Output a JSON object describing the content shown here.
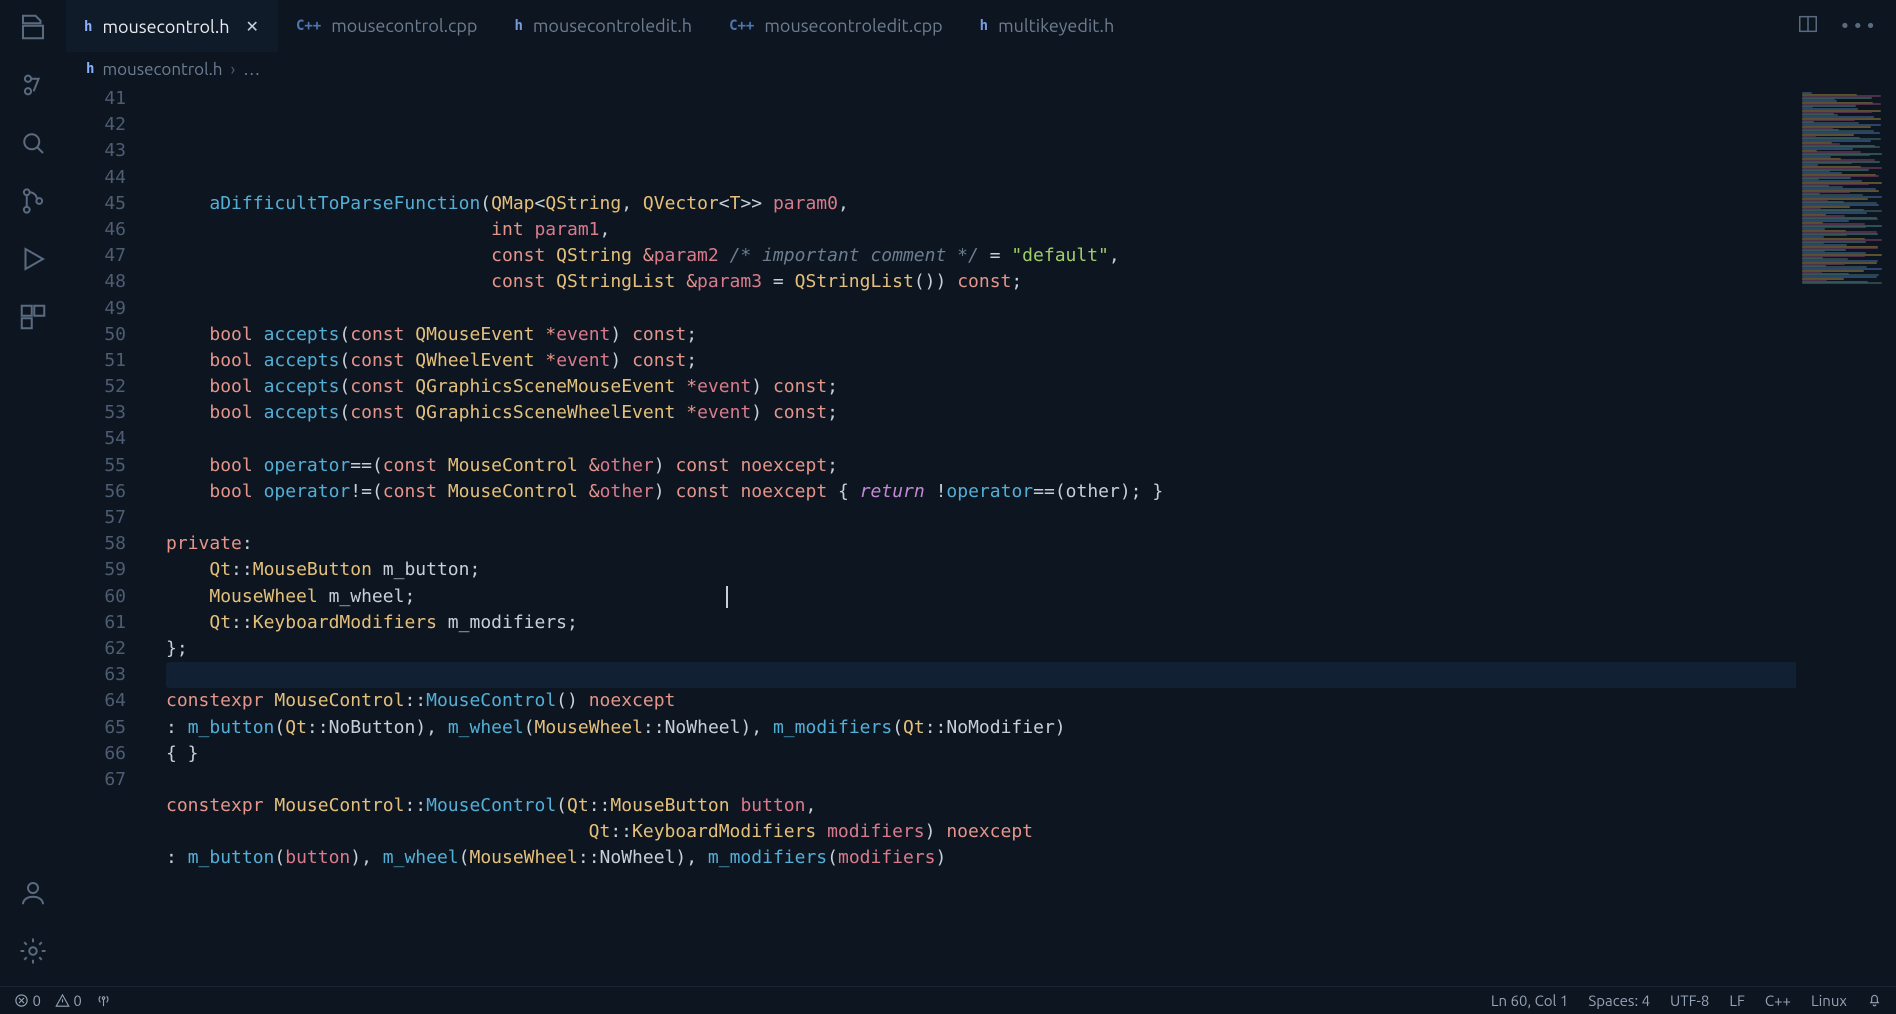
{
  "tabs": [
    {
      "icon": "h",
      "label": "mousecontrol.h",
      "active": true,
      "dirty": false
    },
    {
      "icon": "C++",
      "label": "mousecontrol.cpp",
      "active": false
    },
    {
      "icon": "h",
      "label": "mousecontroledit.h",
      "active": false
    },
    {
      "icon": "C++",
      "label": "mousecontroledit.cpp",
      "active": false
    },
    {
      "icon": "h",
      "label": "multikeyedit.h",
      "active": false
    }
  ],
  "breadcrumb": {
    "icon": "h",
    "file": "mousecontrol.h",
    "trail": "…"
  },
  "editor": {
    "first_line_number": 41,
    "active_line_number": 60,
    "lines": [
      {
        "n": 41,
        "tokens": []
      },
      {
        "n": 42,
        "tokens": [
          [
            "def",
            "    "
          ],
          [
            "func",
            "aDifficultToParseFunction"
          ],
          [
            "pun",
            "("
          ],
          [
            "type",
            "QMap"
          ],
          [
            "pun",
            "<"
          ],
          [
            "type",
            "QString"
          ],
          [
            "pun",
            ", "
          ],
          [
            "type",
            "QVector"
          ],
          [
            "pun",
            "<"
          ],
          [
            "type",
            "T"
          ],
          [
            "pun",
            ">> "
          ],
          [
            "par",
            "param0"
          ],
          [
            "pun",
            ","
          ]
        ]
      },
      {
        "n": 43,
        "tokens": [
          [
            "def",
            "                              "
          ],
          [
            "kw",
            "int"
          ],
          [
            "def",
            " "
          ],
          [
            "par",
            "param1"
          ],
          [
            "pun",
            ","
          ]
        ]
      },
      {
        "n": 44,
        "tokens": [
          [
            "def",
            "                              "
          ],
          [
            "kw",
            "const"
          ],
          [
            "def",
            " "
          ],
          [
            "type",
            "QString"
          ],
          [
            "def",
            " "
          ],
          [
            "kw",
            "&"
          ],
          [
            "par",
            "param2"
          ],
          [
            "def",
            " "
          ],
          [
            "com",
            "/* important comment */"
          ],
          [
            "def",
            " "
          ],
          [
            "pun",
            "="
          ],
          [
            "def",
            " "
          ],
          [
            "str",
            "\"default\""
          ],
          [
            "pun",
            ","
          ]
        ]
      },
      {
        "n": 45,
        "tokens": [
          [
            "def",
            "                              "
          ],
          [
            "kw",
            "const"
          ],
          [
            "def",
            " "
          ],
          [
            "type",
            "QStringList"
          ],
          [
            "def",
            " "
          ],
          [
            "kw",
            "&"
          ],
          [
            "par",
            "param3"
          ],
          [
            "def",
            " "
          ],
          [
            "pun",
            "="
          ],
          [
            "def",
            " "
          ],
          [
            "type",
            "QStringList"
          ],
          [
            "pun",
            "())"
          ],
          [
            "def",
            " "
          ],
          [
            "kw",
            "const"
          ],
          [
            "pun",
            ";"
          ]
        ]
      },
      {
        "n": 46,
        "tokens": []
      },
      {
        "n": 47,
        "tokens": [
          [
            "def",
            "    "
          ],
          [
            "kw",
            "bool"
          ],
          [
            "def",
            " "
          ],
          [
            "func",
            "accepts"
          ],
          [
            "pun",
            "("
          ],
          [
            "kw",
            "const"
          ],
          [
            "def",
            " "
          ],
          [
            "type",
            "QMouseEvent"
          ],
          [
            "def",
            " "
          ],
          [
            "kw",
            "*"
          ],
          [
            "par",
            "event"
          ],
          [
            "pun",
            ")"
          ],
          [
            "def",
            " "
          ],
          [
            "kw",
            "const"
          ],
          [
            "pun",
            ";"
          ]
        ]
      },
      {
        "n": 48,
        "tokens": [
          [
            "def",
            "    "
          ],
          [
            "kw",
            "bool"
          ],
          [
            "def",
            " "
          ],
          [
            "func",
            "accepts"
          ],
          [
            "pun",
            "("
          ],
          [
            "kw",
            "const"
          ],
          [
            "def",
            " "
          ],
          [
            "type",
            "QWheelEvent"
          ],
          [
            "def",
            " "
          ],
          [
            "kw",
            "*"
          ],
          [
            "par",
            "event"
          ],
          [
            "pun",
            ")"
          ],
          [
            "def",
            " "
          ],
          [
            "kw",
            "const"
          ],
          [
            "pun",
            ";"
          ]
        ]
      },
      {
        "n": 49,
        "tokens": [
          [
            "def",
            "    "
          ],
          [
            "kw",
            "bool"
          ],
          [
            "def",
            " "
          ],
          [
            "func",
            "accepts"
          ],
          [
            "pun",
            "("
          ],
          [
            "kw",
            "const"
          ],
          [
            "def",
            " "
          ],
          [
            "type",
            "QGraphicsSceneMouseEvent"
          ],
          [
            "def",
            " "
          ],
          [
            "kw",
            "*"
          ],
          [
            "par",
            "event"
          ],
          [
            "pun",
            ")"
          ],
          [
            "def",
            " "
          ],
          [
            "kw",
            "const"
          ],
          [
            "pun",
            ";"
          ]
        ]
      },
      {
        "n": 50,
        "tokens": [
          [
            "def",
            "    "
          ],
          [
            "kw",
            "bool"
          ],
          [
            "def",
            " "
          ],
          [
            "func",
            "accepts"
          ],
          [
            "pun",
            "("
          ],
          [
            "kw",
            "const"
          ],
          [
            "def",
            " "
          ],
          [
            "type",
            "QGraphicsSceneWheelEvent"
          ],
          [
            "def",
            " "
          ],
          [
            "kw",
            "*"
          ],
          [
            "par",
            "event"
          ],
          [
            "pun",
            ")"
          ],
          [
            "def",
            " "
          ],
          [
            "kw",
            "const"
          ],
          [
            "pun",
            ";"
          ]
        ]
      },
      {
        "n": 51,
        "tokens": []
      },
      {
        "n": 52,
        "tokens": [
          [
            "def",
            "    "
          ],
          [
            "kw",
            "bool"
          ],
          [
            "def",
            " "
          ],
          [
            "func",
            "operator"
          ],
          [
            "pun",
            "=="
          ],
          [
            "pun",
            "("
          ],
          [
            "kw",
            "const"
          ],
          [
            "def",
            " "
          ],
          [
            "type",
            "MouseControl"
          ],
          [
            "def",
            " "
          ],
          [
            "kw",
            "&"
          ],
          [
            "par",
            "other"
          ],
          [
            "pun",
            ")"
          ],
          [
            "def",
            " "
          ],
          [
            "kw",
            "const"
          ],
          [
            "def",
            " "
          ],
          [
            "kw",
            "noexcept"
          ],
          [
            "pun",
            ";"
          ]
        ]
      },
      {
        "n": 53,
        "tokens": [
          [
            "def",
            "    "
          ],
          [
            "kw",
            "bool"
          ],
          [
            "def",
            " "
          ],
          [
            "func",
            "operator"
          ],
          [
            "pun",
            "!="
          ],
          [
            "pun",
            "("
          ],
          [
            "kw",
            "const"
          ],
          [
            "def",
            " "
          ],
          [
            "type",
            "MouseControl"
          ],
          [
            "def",
            " "
          ],
          [
            "kw",
            "&"
          ],
          [
            "par",
            "other"
          ],
          [
            "pun",
            ")"
          ],
          [
            "def",
            " "
          ],
          [
            "kw",
            "const"
          ],
          [
            "def",
            " "
          ],
          [
            "kw",
            "noexcept"
          ],
          [
            "def",
            " "
          ],
          [
            "pun",
            "{"
          ],
          [
            "def",
            " "
          ],
          [
            "kw2",
            "return"
          ],
          [
            "def",
            " "
          ],
          [
            "pun",
            "!"
          ],
          [
            "func",
            "operator"
          ],
          [
            "pun",
            "=="
          ],
          [
            "pun",
            "("
          ],
          [
            "def",
            "other"
          ],
          [
            "pun",
            "); }"
          ]
        ]
      },
      {
        "n": 54,
        "tokens": []
      },
      {
        "n": 55,
        "tokens": [
          [
            "lbl",
            "private"
          ],
          [
            "pun",
            ":"
          ]
        ]
      },
      {
        "n": 56,
        "tokens": [
          [
            "def",
            "    "
          ],
          [
            "type",
            "Qt"
          ],
          [
            "pun",
            "::"
          ],
          [
            "type",
            "MouseButton"
          ],
          [
            "def",
            " m_button"
          ],
          [
            "pun",
            ";"
          ]
        ]
      },
      {
        "n": 57,
        "tokens": [
          [
            "def",
            "    "
          ],
          [
            "type",
            "MouseWheel"
          ],
          [
            "def",
            " m_wheel"
          ],
          [
            "pun",
            ";"
          ]
        ]
      },
      {
        "n": 58,
        "tokens": [
          [
            "def",
            "    "
          ],
          [
            "type",
            "Qt"
          ],
          [
            "pun",
            "::"
          ],
          [
            "type",
            "KeyboardModifiers"
          ],
          [
            "def",
            " m_modifiers"
          ],
          [
            "pun",
            ";"
          ]
        ]
      },
      {
        "n": 59,
        "tokens": [
          [
            "pun",
            "};"
          ]
        ]
      },
      {
        "n": 60,
        "tokens": []
      },
      {
        "n": 61,
        "tokens": [
          [
            "kw",
            "constexpr"
          ],
          [
            "def",
            " "
          ],
          [
            "type",
            "MouseControl"
          ],
          [
            "pun",
            "::"
          ],
          [
            "func",
            "MouseControl"
          ],
          [
            "pun",
            "()"
          ],
          [
            "def",
            " "
          ],
          [
            "kw",
            "noexcept"
          ]
        ]
      },
      {
        "n": 62,
        "tokens": [
          [
            "pun",
            ": "
          ],
          [
            "func",
            "m_button"
          ],
          [
            "pun",
            "("
          ],
          [
            "type",
            "Qt"
          ],
          [
            "pun",
            "::"
          ],
          [
            "def",
            "NoButton"
          ],
          [
            "pun",
            "), "
          ],
          [
            "func",
            "m_wheel"
          ],
          [
            "pun",
            "("
          ],
          [
            "type",
            "MouseWheel"
          ],
          [
            "pun",
            "::"
          ],
          [
            "def",
            "NoWheel"
          ],
          [
            "pun",
            "), "
          ],
          [
            "func",
            "m_modifiers"
          ],
          [
            "pun",
            "("
          ],
          [
            "type",
            "Qt"
          ],
          [
            "pun",
            "::"
          ],
          [
            "def",
            "NoModifier"
          ],
          [
            "pun",
            ")"
          ]
        ]
      },
      {
        "n": 63,
        "tokens": [
          [
            "pun",
            "{ }"
          ]
        ]
      },
      {
        "n": 64,
        "tokens": []
      },
      {
        "n": 65,
        "tokens": [
          [
            "kw",
            "constexpr"
          ],
          [
            "def",
            " "
          ],
          [
            "type",
            "MouseControl"
          ],
          [
            "pun",
            "::"
          ],
          [
            "func",
            "MouseControl"
          ],
          [
            "pun",
            "("
          ],
          [
            "type",
            "Qt"
          ],
          [
            "pun",
            "::"
          ],
          [
            "type",
            "MouseButton"
          ],
          [
            "def",
            " "
          ],
          [
            "par",
            "button"
          ],
          [
            "pun",
            ","
          ]
        ]
      },
      {
        "n": 66,
        "tokens": [
          [
            "def",
            "                                       "
          ],
          [
            "type",
            "Qt"
          ],
          [
            "pun",
            "::"
          ],
          [
            "type",
            "KeyboardModifiers"
          ],
          [
            "def",
            " "
          ],
          [
            "par",
            "modifiers"
          ],
          [
            "pun",
            ")"
          ],
          [
            "def",
            " "
          ],
          [
            "kw",
            "noexcept"
          ]
        ]
      },
      {
        "n": 67,
        "tokens": [
          [
            "pun",
            ": "
          ],
          [
            "func",
            "m_button"
          ],
          [
            "pun",
            "("
          ],
          [
            "par",
            "button"
          ],
          [
            "pun",
            "), "
          ],
          [
            "func",
            "m_wheel"
          ],
          [
            "pun",
            "("
          ],
          [
            "type",
            "MouseWheel"
          ],
          [
            "pun",
            "::"
          ],
          [
            "def",
            "NoWheel"
          ],
          [
            "pun",
            "), "
          ],
          [
            "func",
            "m_modifiers"
          ],
          [
            "pun",
            "("
          ],
          [
            "par",
            "modifiers"
          ],
          [
            "pun",
            ")"
          ]
        ]
      }
    ]
  },
  "status": {
    "errors": "0",
    "warnings": "0",
    "ln_col": "Ln 60, Col 1",
    "spaces": "Spaces: 4",
    "encoding": "UTF-8",
    "eol": "LF",
    "lang": "C++",
    "os": "Linux"
  }
}
